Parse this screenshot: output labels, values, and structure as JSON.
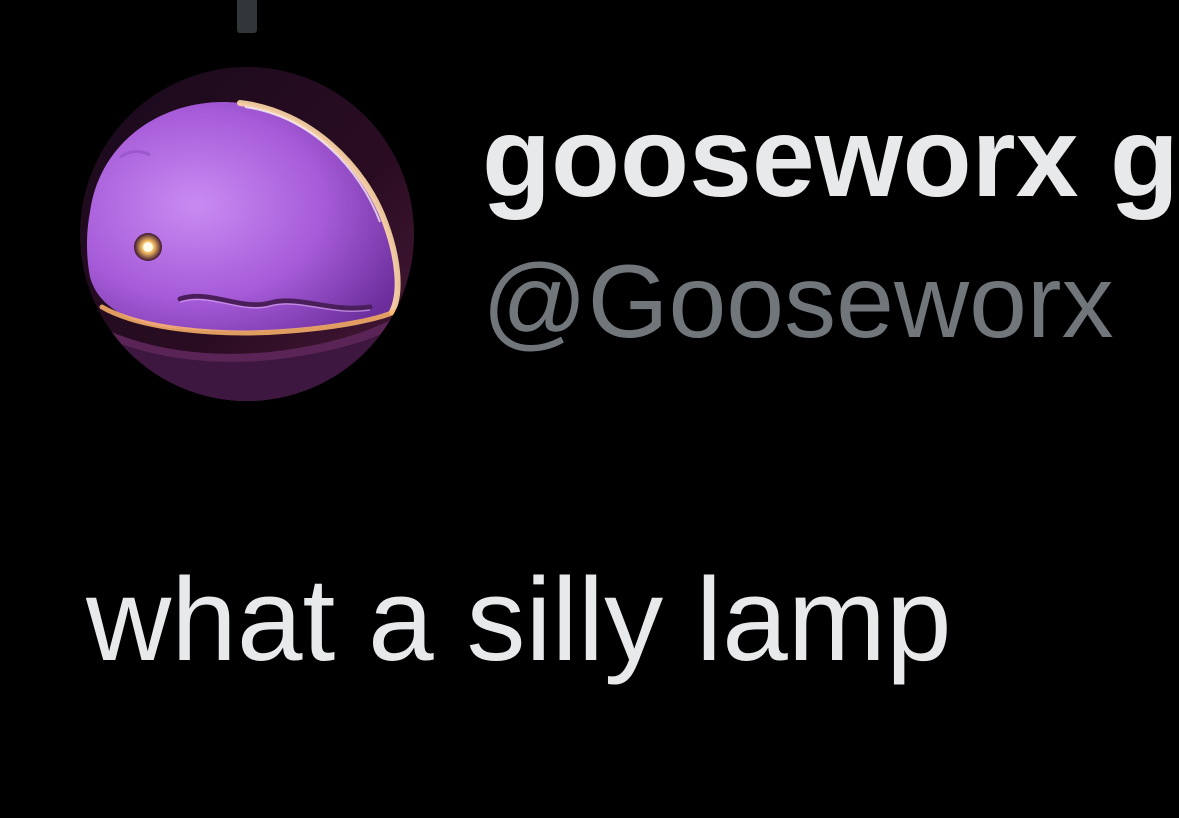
{
  "post": {
    "author": {
      "display_name": "gooseworx g",
      "handle": "@Gooseworx",
      "avatar_icon": "purple-whale-lamp-avatar"
    },
    "text": "what a silly lamp"
  },
  "colors": {
    "background": "#000000",
    "primary_text": "#e7e9ea",
    "secondary_text": "#71767b",
    "thread_line": "#333639"
  }
}
